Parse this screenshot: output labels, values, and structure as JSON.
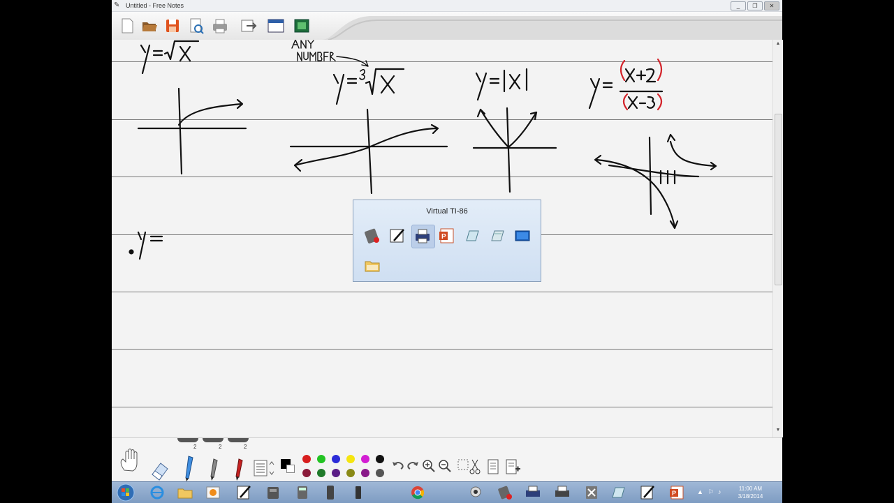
{
  "window": {
    "title": "Untitled - Free Notes",
    "minimize": "_",
    "restore": "❐",
    "close": "✕"
  },
  "toolbar": {
    "buttons": [
      "new-icon",
      "open-folder-icon",
      "save-icon",
      "print-preview-icon",
      "print-icon",
      "export-icon",
      "window-icon",
      "screen-capture-icon"
    ]
  },
  "notes": {
    "handwriting": [
      "y = √x",
      "ANY NUMBER",
      "y = ³√x",
      "y = |x|",
      "y = (x+2)/(x-3)",
      "y ="
    ],
    "ink_color": "#111111",
    "highlight_color": "#d3242b"
  },
  "popup": {
    "title": "Virtual TI-86",
    "icons": [
      "calculator-icon",
      "pen-icon",
      "printer-icon",
      "powerpoint-icon",
      "notes-icon",
      "notes-alt-icon",
      "monitor-icon",
      "folder-icon"
    ]
  },
  "bottom_tools": {
    "widths": [
      "2",
      "2",
      "2"
    ],
    "colors_row1": [
      "#d81e1e",
      "#22c322",
      "#2b2bd8",
      "#f5e50f",
      "#d31ed3",
      "#111111"
    ],
    "colors_row2": [
      "#8a1a3a",
      "#1f7a2a",
      "#5a1d86",
      "#8a8a16",
      "#8a1a8a",
      "#555555"
    ]
  },
  "taskbar": {
    "time": "11:00 AM",
    "date": "3/18/2014"
  }
}
